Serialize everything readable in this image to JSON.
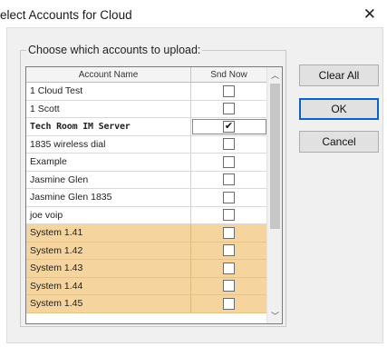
{
  "window": {
    "title": "elect Accounts for Cloud",
    "close_glyph": "✕"
  },
  "group": {
    "legend": "Choose which accounts to upload:"
  },
  "table": {
    "columns": [
      "Account Name",
      "Snd Now"
    ],
    "rows": [
      {
        "name": "1 Cloud Test",
        "checked": false,
        "style": "normal"
      },
      {
        "name": "1 Scott",
        "checked": false,
        "style": "normal"
      },
      {
        "name": "Tech Room IM Server",
        "checked": true,
        "style": "bold"
      },
      {
        "name": "1835 wireless dial",
        "checked": false,
        "style": "normal"
      },
      {
        "name": "Example",
        "checked": false,
        "style": "normal"
      },
      {
        "name": "Jasmine Glen",
        "checked": false,
        "style": "normal"
      },
      {
        "name": "Jasmine Glen 1835",
        "checked": false,
        "style": "normal"
      },
      {
        "name": "joe voip",
        "checked": false,
        "style": "normal"
      },
      {
        "name": "System 1.41",
        "checked": false,
        "style": "system"
      },
      {
        "name": "System 1.42",
        "checked": false,
        "style": "system"
      },
      {
        "name": "System 1.43",
        "checked": false,
        "style": "system"
      },
      {
        "name": "System 1.44",
        "checked": false,
        "style": "system"
      },
      {
        "name": "System 1.45",
        "checked": false,
        "style": "system"
      }
    ],
    "scroll": {
      "up_glyph": "︿",
      "down_glyph": "﹀"
    }
  },
  "buttons": {
    "clear_all": "Clear All",
    "ok": "OK",
    "cancel": "Cancel"
  },
  "colors": {
    "system_row": "#f5d59d",
    "default_button_border": "#0a64c8"
  }
}
